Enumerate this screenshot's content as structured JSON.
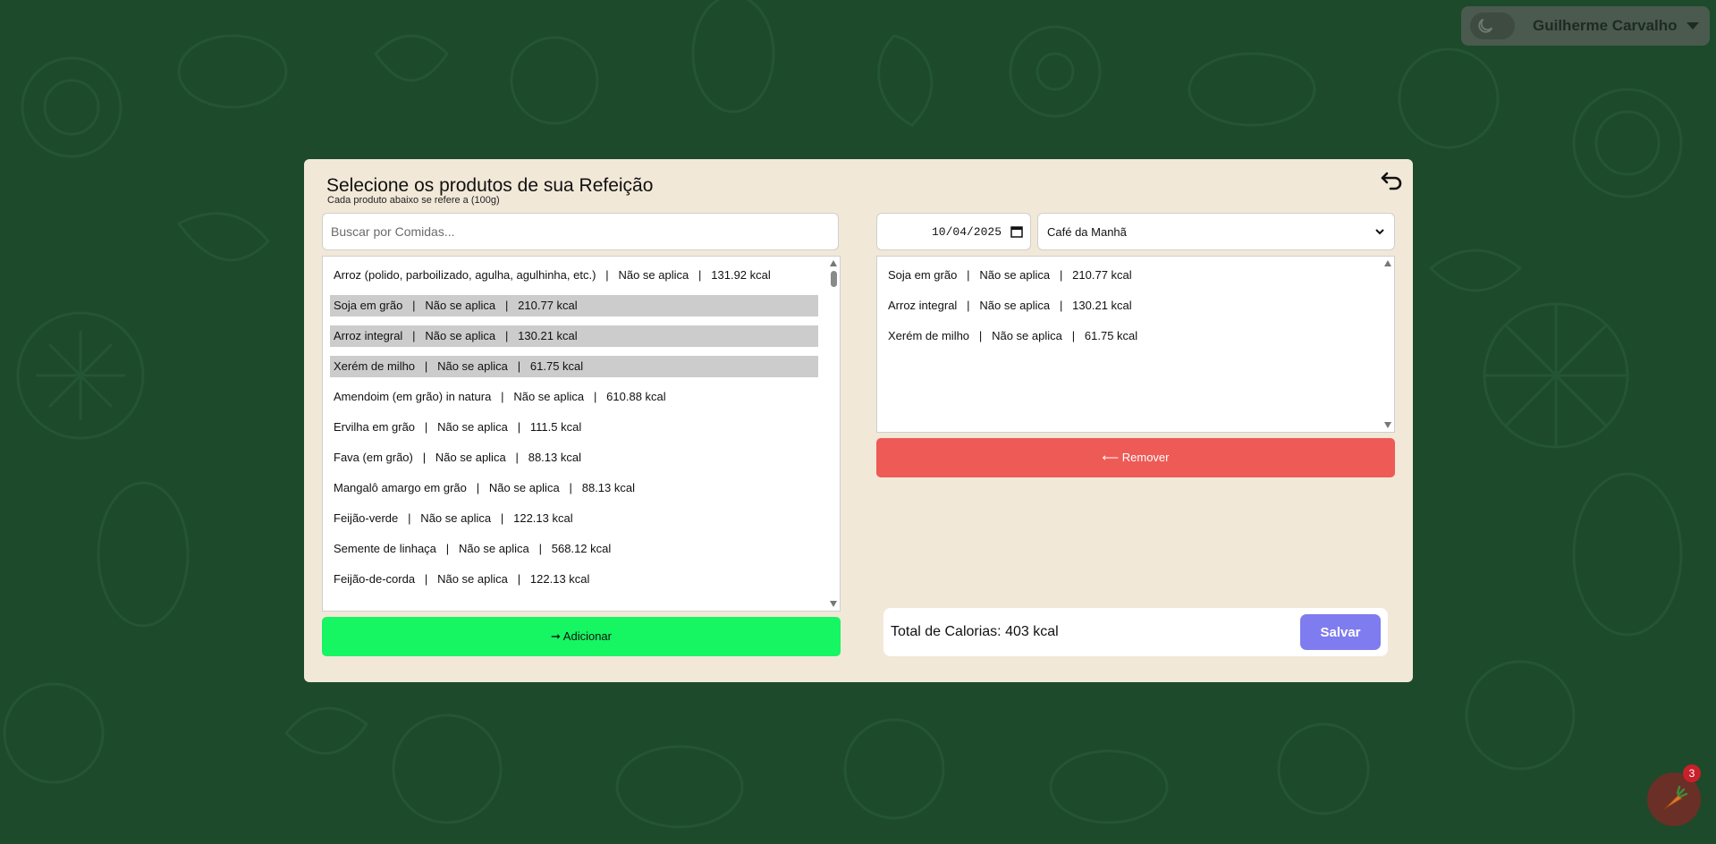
{
  "user": {
    "name": "Guilherme Carvalho",
    "theme_icon": "moon-icon"
  },
  "modal": {
    "title": "Selecione os produtos de sua Refeição",
    "subtitle": "Cada produto abaixo se refere a (100g)"
  },
  "search": {
    "placeholder": "Buscar por Comidas...",
    "value": ""
  },
  "food_list": [
    {
      "text": "Arroz (polido, parboilizado, agulha, agulhinha, etc.)   |   Não se aplica   |   131.92 kcal",
      "selected": false
    },
    {
      "text": "Soja em grão   |   Não se aplica   |   210.77 kcal",
      "selected": true
    },
    {
      "text": "Arroz integral   |   Não se aplica   |   130.21 kcal",
      "selected": true
    },
    {
      "text": "Xerém de milho   |   Não se aplica   |   61.75 kcal",
      "selected": true
    },
    {
      "text": "Amendoim (em grão) in natura   |   Não se aplica   |   610.88 kcal",
      "selected": false
    },
    {
      "text": "Ervilha em grão   |   Não se aplica   |   111.5 kcal",
      "selected": false
    },
    {
      "text": "Fava (em grão)   |   Não se aplica   |   88.13 kcal",
      "selected": false
    },
    {
      "text": "Mangalô amargo em grão   |   Não se aplica   |   88.13 kcal",
      "selected": false
    },
    {
      "text": "Feijão-verde   |   Não se aplica   |   122.13 kcal",
      "selected": false
    },
    {
      "text": "Semente de linhaça   |   Não se aplica   |   568.12 kcal",
      "selected": false
    },
    {
      "text": "Feijão-de-corda   |   Não se aplica   |   122.13 kcal",
      "selected": false
    }
  ],
  "add_button_label": "➞ Adicionar",
  "date": {
    "value": "10/04/2025"
  },
  "meal_type": {
    "selected": "Café da Manhã"
  },
  "selected_list": [
    "Soja em grão   |   Não se aplica   |   210.77 kcal",
    "Arroz integral   |   Não se aplica   |   130.21 kcal",
    "Xerém de milho   |   Não se aplica   |   61.75 kcal"
  ],
  "remove_button_label": "⟵ Remover",
  "total": {
    "label": "Total de Calorias: 403 kcal"
  },
  "save_button_label": "Salvar",
  "notification": {
    "count": "3"
  },
  "colors": {
    "background": "#1d4a2a",
    "modal": "#f2e8d8",
    "add": "#16f562",
    "remove": "#ee5a56",
    "save": "#7f7cef",
    "selected_row": "#cccccc"
  }
}
